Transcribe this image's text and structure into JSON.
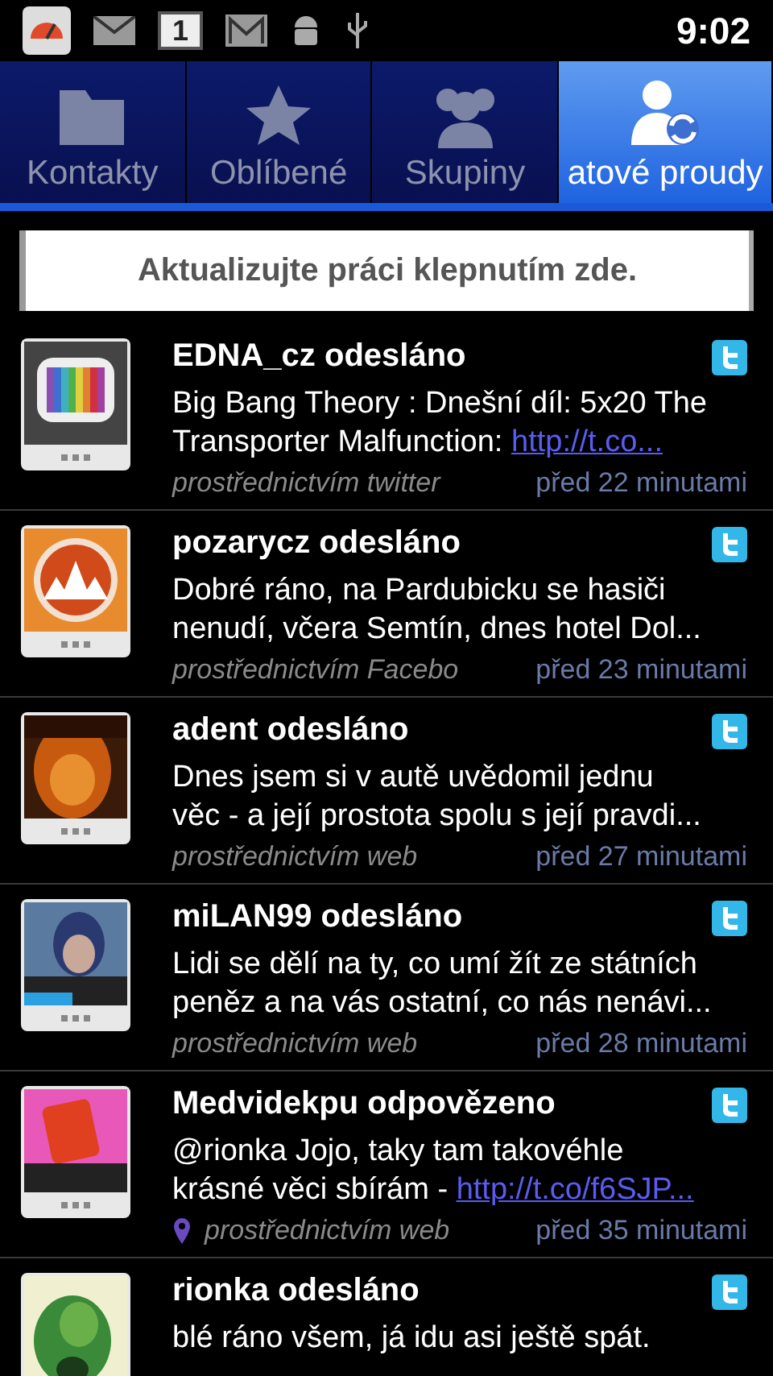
{
  "status_bar": {
    "calendar_day": "1",
    "time": "9:02"
  },
  "tabs": [
    {
      "label": "Kontakty",
      "selected": false
    },
    {
      "label": "Oblíbené",
      "selected": false
    },
    {
      "label": "Skupiny",
      "selected": false
    },
    {
      "label": "atové proudy",
      "selected": true
    }
  ],
  "refresh_banner": "Aktualizujte práci klepnutím zde.",
  "posts": [
    {
      "title": "EDNA_cz odesláno",
      "body": "Big Bang Theory : Dnešní díl: 5x20 The\nTransporter Malfunction:  ",
      "link": "http://t.co...",
      "location": false,
      "source": "prostřednictvím twitter",
      "time": "před 22 minutami"
    },
    {
      "title": "pozarycz odesláno",
      "body": "Dobré ráno, na Pardubicku se hasiči\nnenudí, včera Semtín, dnes hotel Dol...",
      "location": false,
      "source": "prostřednictvím Facebo",
      "time": "před 23 minutami"
    },
    {
      "title": "adent odesláno",
      "body": "Dnes jsem si v autě uvědomil jednu\nvěc - a její prostota spolu s její pravdi...",
      "location": false,
      "source": "prostřednictvím web",
      "time": "před 27 minutami"
    },
    {
      "title": "miLAN99 odesláno",
      "body": "Lidi se dělí na ty, co umí žít ze státních\npeněz a na vás ostatní, co nás nenávi...",
      "location": false,
      "source": "prostřednictvím web",
      "time": "před 28 minutami"
    },
    {
      "title": "Medvidekpu odpovězeno",
      "body": "@rionka Jojo, taky tam takovéhle\nkrásné věci sbírám - ",
      "link": "http://t.co/f6SJP...",
      "location": true,
      "source": "prostřednictvím web",
      "time": "před 35 minutami"
    },
    {
      "title": "rionka odesláno",
      "body": "blé ráno všem, já idu asi ještě spát."
    }
  ]
}
